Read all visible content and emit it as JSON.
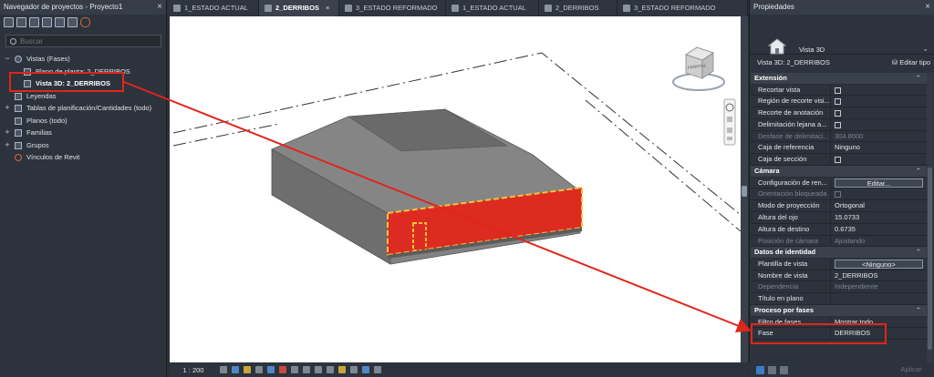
{
  "project_browser": {
    "title": "Navegador de proyectos - Proyecto1",
    "search_placeholder": "Buscar",
    "items": [
      {
        "label": "Vistas (Fases)",
        "expander": "−"
      },
      {
        "label": "Plano de planta: 2_DERRIBOS",
        "expander": ""
      },
      {
        "label": "Vista 3D: 2_DERRIBOS",
        "expander": ""
      },
      {
        "label": "Leyendas",
        "expander": ""
      },
      {
        "label": "Tablas de planificación/Cantidades (todo)",
        "expander": "+"
      },
      {
        "label": "Planos (todo)",
        "expander": ""
      },
      {
        "label": "Familias",
        "expander": "+"
      },
      {
        "label": "Grupos",
        "expander": "+"
      },
      {
        "label": "Vínculos de Revit",
        "expander": ""
      }
    ]
  },
  "tabs": [
    {
      "label": "1_ESTADO ACTUAL"
    },
    {
      "label": "2_DERRIBOS",
      "close": "×"
    },
    {
      "label": "3_ESTADO REFORMADO"
    },
    {
      "label": "1_ESTADO ACTUAL"
    },
    {
      "label": "2_DERRIBOS"
    },
    {
      "label": "3_ESTADO REFORMADO"
    }
  ],
  "viewcube": {
    "face_label": "FRONTAL"
  },
  "statusbar": {
    "scale": "1 : 200"
  },
  "properties": {
    "title": "Propiedades",
    "type_name": "Vista 3D",
    "view_selector": "Vista 3D: 2_DERRIBOS",
    "edit_type": "Editar tipo",
    "apply": "Aplicar",
    "groups": [
      {
        "name": "Extensión",
        "rows": [
          {
            "name": "Recortar vista",
            "value": "",
            "kind": "check"
          },
          {
            "name": "Región de recorte visi...",
            "value": "",
            "kind": "check"
          },
          {
            "name": "Recorte de anotación",
            "value": "",
            "kind": "check"
          },
          {
            "name": "Delimitación lejana a...",
            "value": "",
            "kind": "check"
          },
          {
            "name": "Desfase de delimitaci...",
            "value": "304.8000",
            "kind": "text",
            "dim": true
          },
          {
            "name": "Caja de referencia",
            "value": "Ninguno",
            "kind": "text"
          },
          {
            "name": "Caja de sección",
            "value": "",
            "kind": "check"
          }
        ]
      },
      {
        "name": "Cámara",
        "rows": [
          {
            "name": "Configuración de ren...",
            "value": "Editar...",
            "kind": "button"
          },
          {
            "name": "Orientación bloqueada",
            "value": "",
            "kind": "check",
            "dim": true
          },
          {
            "name": "Modo de proyección",
            "value": "Ortogonal",
            "kind": "text"
          },
          {
            "name": "Altura del ojo",
            "value": "15.0733",
            "kind": "text"
          },
          {
            "name": "Altura de destino",
            "value": "0.6735",
            "kind": "text"
          },
          {
            "name": "Posición de cámara",
            "value": "Ajustando",
            "kind": "text",
            "dim": true
          }
        ]
      },
      {
        "name": "Datos de identidad",
        "rows": [
          {
            "name": "Plantilla de vista",
            "value": "<Ninguno>",
            "kind": "button"
          },
          {
            "name": "Nombre de vista",
            "value": "2_DERRIBOS",
            "kind": "text"
          },
          {
            "name": "Dependencia",
            "value": "Independiente",
            "kind": "text",
            "dim": true
          },
          {
            "name": "Título en plano",
            "value": "",
            "kind": "text"
          }
        ]
      },
      {
        "name": "Proceso por fases",
        "rows": [
          {
            "name": "Filtro de fases",
            "value": "Mostrar todo",
            "kind": "text"
          },
          {
            "name": "Fase",
            "value": "DERRIBOS",
            "kind": "text"
          }
        ]
      }
    ]
  },
  "colors": {
    "highlight": "#e0251b",
    "demolition_fill": "#dd2b21",
    "model_gray": "#7a7a7a",
    "panel_bg": "#2d333c"
  }
}
